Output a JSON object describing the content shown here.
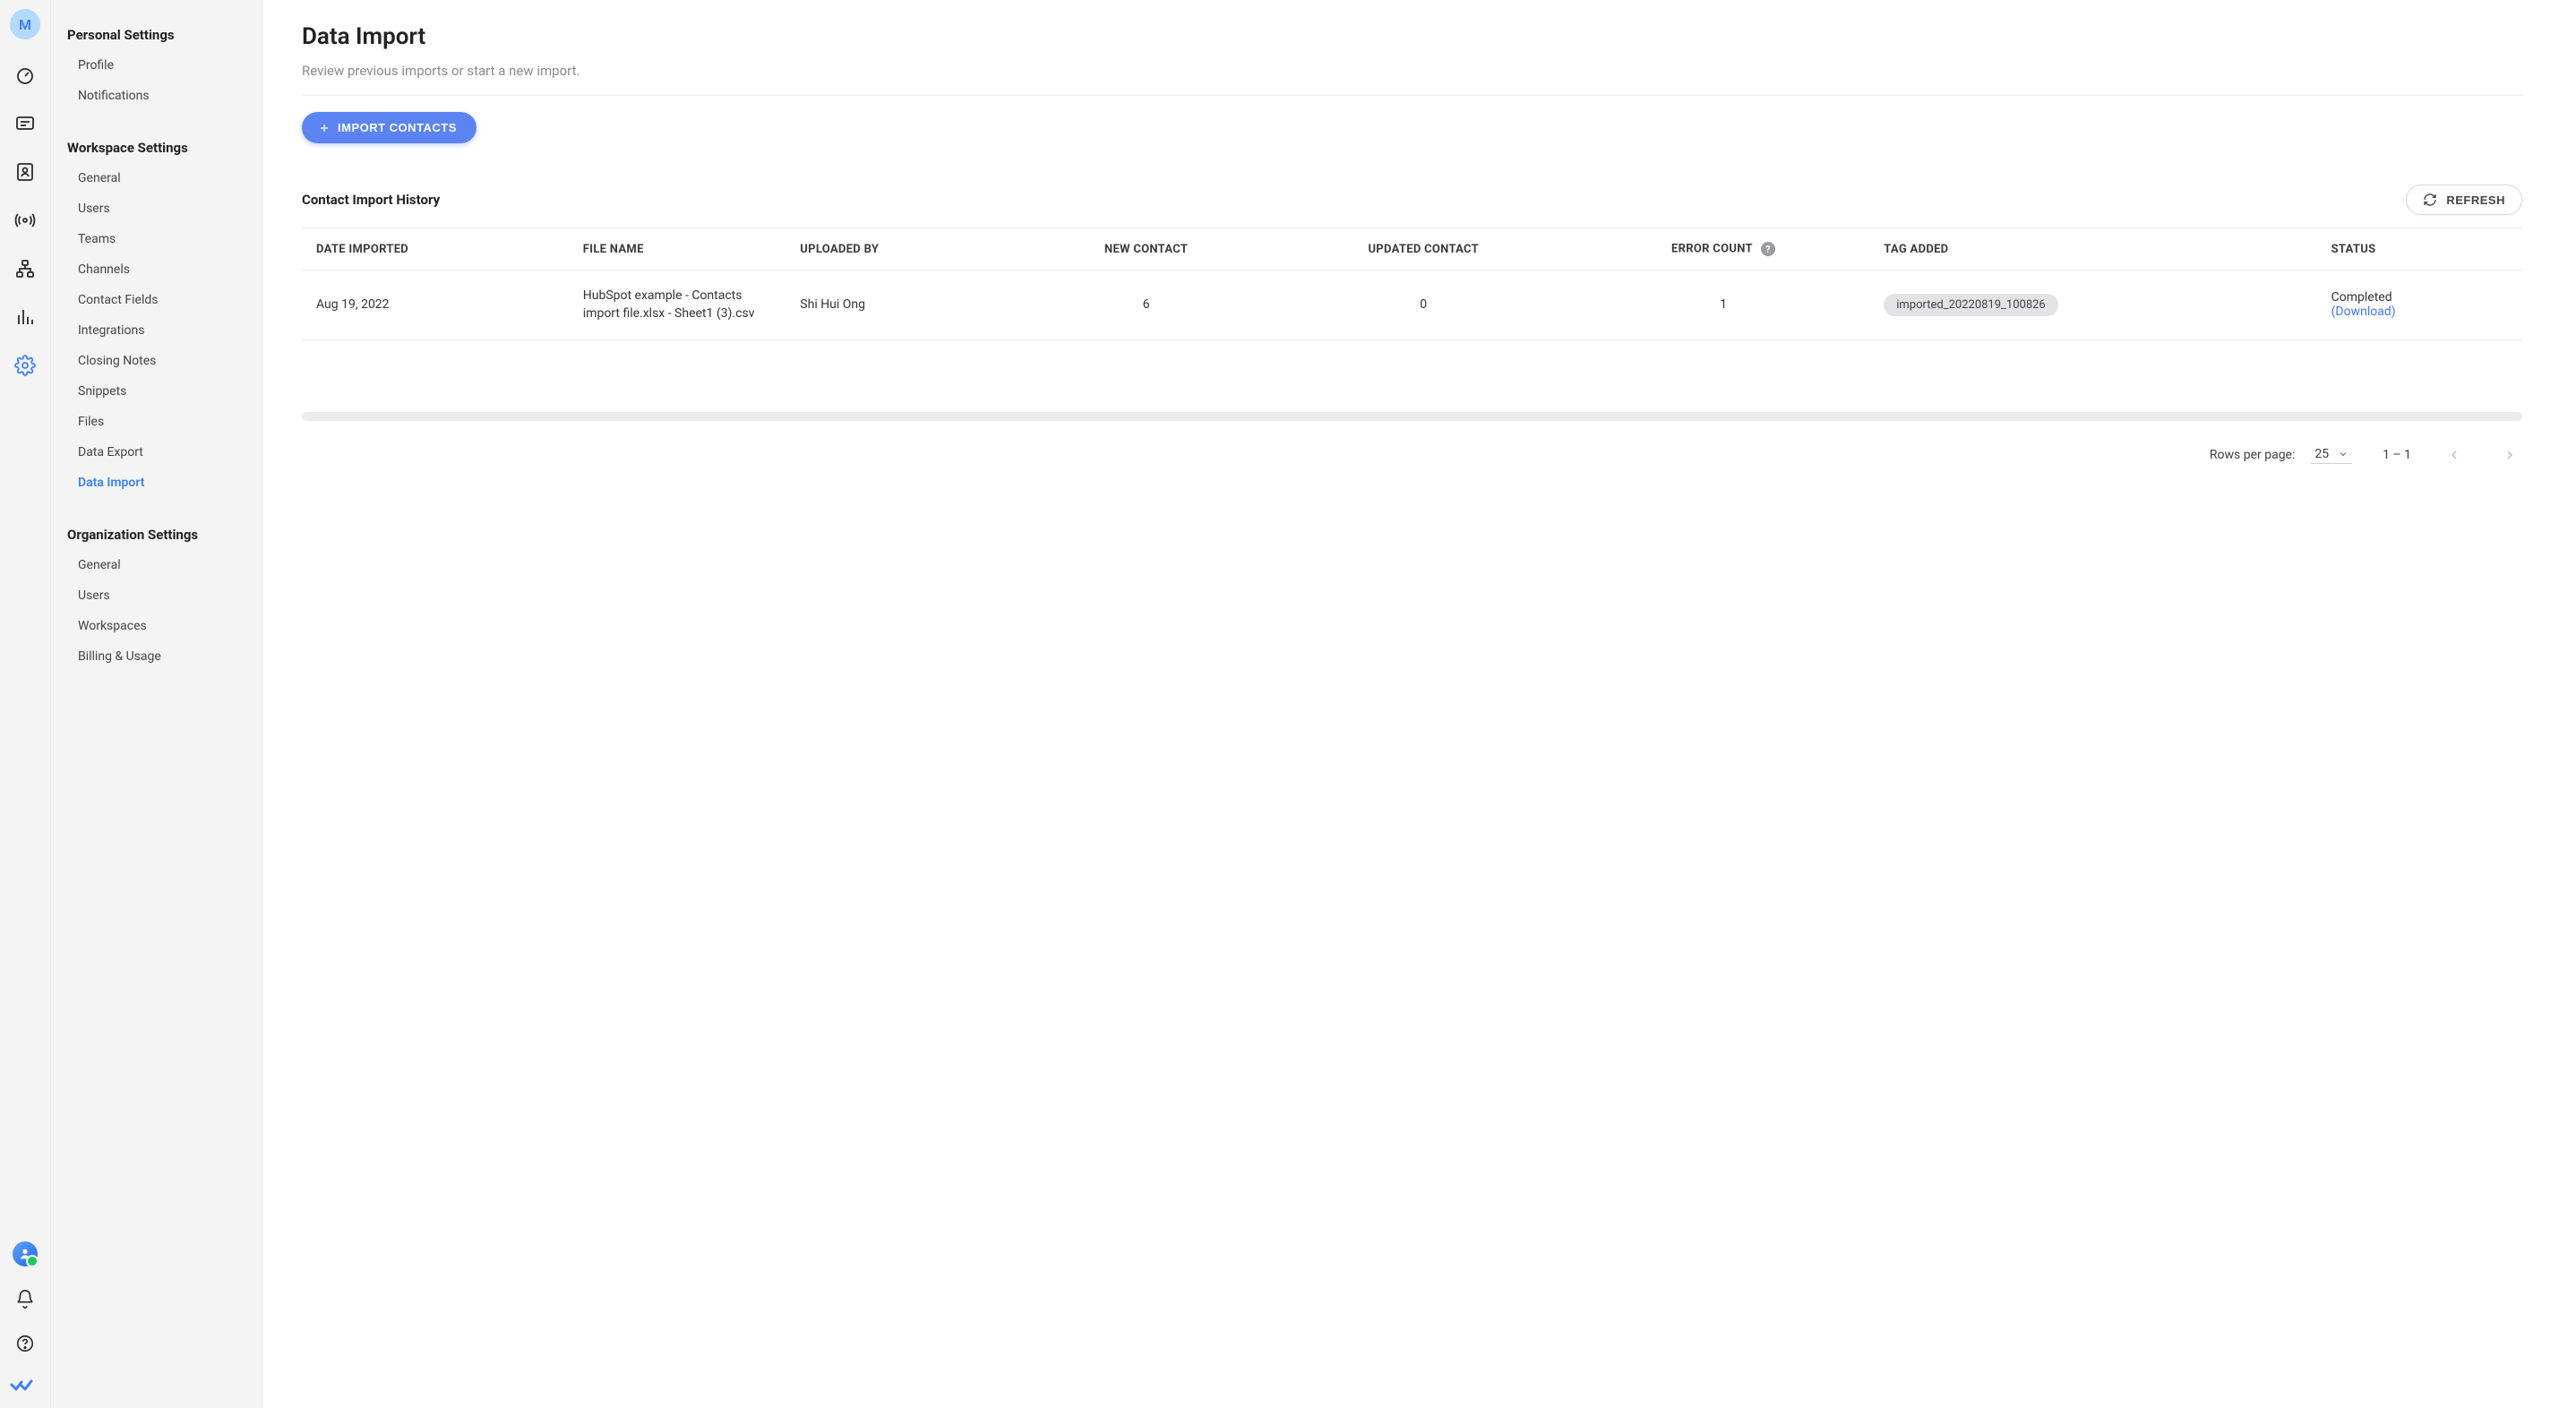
{
  "avatar_initial": "M",
  "sidebar": {
    "personal": {
      "title": "Personal Settings",
      "items": [
        "Profile",
        "Notifications"
      ]
    },
    "workspace": {
      "title": "Workspace Settings",
      "items": [
        "General",
        "Users",
        "Teams",
        "Channels",
        "Contact Fields",
        "Integrations",
        "Closing Notes",
        "Snippets",
        "Files",
        "Data Export",
        "Data Import"
      ],
      "active_index": 10
    },
    "organization": {
      "title": "Organization Settings",
      "items": [
        "General",
        "Users",
        "Workspaces",
        "Billing & Usage"
      ]
    }
  },
  "page": {
    "title": "Data Import",
    "subtitle": "Review previous imports or start a new import.",
    "import_button": "IMPORT CONTACTS",
    "history_title": "Contact Import History",
    "refresh_button": "REFRESH"
  },
  "table": {
    "headers": {
      "date": "DATE IMPORTED",
      "file": "FILE NAME",
      "uploaded_by": "UPLOADED BY",
      "new_contact": "NEW CONTACT",
      "updated_contact": "UPDATED CONTACT",
      "error_count": "ERROR COUNT",
      "tag_added": "TAG ADDED",
      "status": "STATUS"
    },
    "rows": [
      {
        "date": "Aug 19, 2022",
        "file": "HubSpot example - Contacts import file.xlsx - Sheet1 (3).csv",
        "uploaded_by": "Shi Hui Ong",
        "new_contact": "6",
        "updated_contact": "0",
        "error_count": "1",
        "tag_added": "imported_20220819_100826",
        "status": "Completed",
        "download": "(Download)"
      }
    ]
  },
  "pagination": {
    "rows_label": "Rows per page:",
    "rows_value": "25",
    "range": "1 – 1"
  }
}
